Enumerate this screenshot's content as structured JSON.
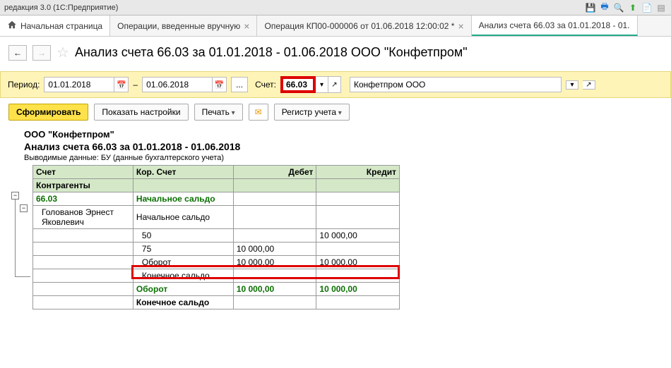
{
  "titlebar": {
    "text": "редакция 3.0  (1С:Предприятие)"
  },
  "tabs": {
    "home": "Начальная страница",
    "items": [
      "Операции, введенные вручную",
      "Операция КП00-000006 от 01.06.2018 12:00:02 *",
      "Анализ счета 66.03 за 01.01.2018 - 01."
    ]
  },
  "page": {
    "title": "Анализ счета 66.03 за 01.01.2018 - 01.06.2018 ООО \"Конфетпром\""
  },
  "period": {
    "label": "Период:",
    "from": "01.01.2018",
    "dash": "–",
    "to": "01.06.2018",
    "dots": "...",
    "acct_label": "Счет:",
    "acct": "66.03",
    "org": "Конфетпром ООО"
  },
  "actions": {
    "form": "Сформировать",
    "show_settings": "Показать настройки",
    "print": "Печать",
    "register": "Регистр учета"
  },
  "report": {
    "org": "ООО \"Конфетпром\"",
    "title": "Анализ счета 66.03 за 01.01.2018 - 01.06.2018",
    "sub": "Выводимые данные:  БУ (данные бухгалтерского учета)",
    "headers": {
      "acct": "Счет",
      "kor": "Кор. Счет",
      "debit": "Дебет",
      "credit": "Кредит"
    },
    "sub1": "Контрагенты",
    "rows": [
      {
        "a": "66.03",
        "k": "Начальное сальдо",
        "d": "",
        "c": ""
      },
      {
        "a": "Голованов Эрнест Яковлевич",
        "k": "Начальное сальдо",
        "d": "",
        "c": ""
      },
      {
        "a": "",
        "k": "50",
        "d": "",
        "c": "10 000,00"
      },
      {
        "a": "",
        "k": "75",
        "d": "10 000,00",
        "c": ""
      },
      {
        "a": "",
        "k": "Оборот",
        "d": "10 000,00",
        "c": "10 000,00"
      },
      {
        "a": "",
        "k": "Конечное сальдо",
        "d": "",
        "c": ""
      },
      {
        "a": "",
        "k": "Оборот",
        "d": "10 000,00",
        "c": "10 000,00"
      },
      {
        "a": "",
        "k": "Конечное сальдо",
        "d": "",
        "c": ""
      }
    ]
  }
}
